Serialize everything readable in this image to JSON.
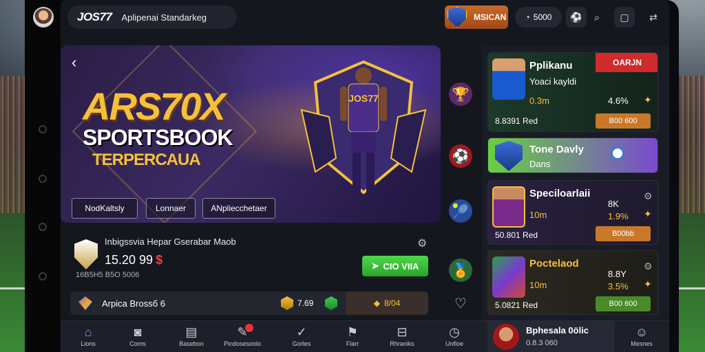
{
  "brand": {
    "logo": "JOS77",
    "subtitle": "Aplipenai Standarkeg"
  },
  "topbar": {
    "vip_label": "MSICAN",
    "balance": "5000"
  },
  "hero": {
    "title": "ARS70X",
    "subtitle": "SPORTSBOOK",
    "tagline": "TERPERCAUA",
    "jersey_text": "JOS77",
    "buttons": [
      "NodKaltsly",
      "Lonnaer",
      "ANpliecchetaer"
    ]
  },
  "match": {
    "title": "Inbigssvia Hepar Gserabar Maob",
    "odds": "15.20 99",
    "currency": "$",
    "meta": "16B5H5 B5O 5006",
    "go_label": "CIO VIIA"
  },
  "bet_strip": {
    "label": "Arpica Brossб 6",
    "value": "7.69",
    "box_value": "8/04"
  },
  "cards": [
    {
      "title": "Pplikanu",
      "badge": "OARJN",
      "line": "Yoaci kayldi",
      "line2": "0.3m",
      "pct": "4.6%",
      "stat": "8.8391 Red",
      "amount": "B00 600"
    },
    {
      "title": "Tone Davly",
      "line": "Dans"
    },
    {
      "title": "Speciloarlaii",
      "line": "10m",
      "line2": "8K",
      "pct": "1.9%",
      "stat": "50.801 Red",
      "amount": "B00bb"
    },
    {
      "title": "Poctelaod",
      "line": "10m",
      "line2": "8.8Y",
      "pct": "3.5%",
      "stat": "5.0821 Red",
      "amount": "B00 600"
    }
  ],
  "nav": {
    "items": [
      "Lions",
      "Coms",
      "Basebon",
      "Pindosesoolo",
      "Gorles",
      "Flarr",
      "Rhraniks",
      "Unfioe"
    ],
    "user_name": "Bphesala 0ölic",
    "user_sub": "0.8.3 060",
    "last_label": "Mesnes"
  },
  "colors": {
    "accent_gold": "#f5c13a",
    "go_green": "#3cc23a",
    "card_orange": "#c9782a",
    "danger_red": "#e8323a"
  },
  "icons": [
    "back-icon",
    "balance-icon",
    "ball-icon",
    "search-icon",
    "tablet-icon",
    "share-icon",
    "gear-icon",
    "star-icon",
    "heart-icon",
    "home-icon",
    "camera-icon",
    "check-icon",
    "user-icon"
  ]
}
